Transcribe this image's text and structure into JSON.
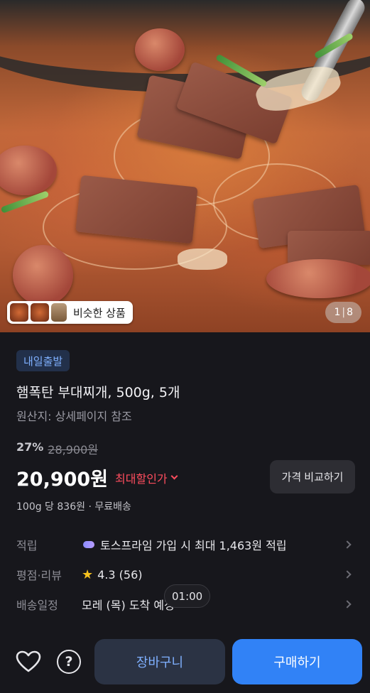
{
  "hero": {
    "similar_label": "비슷한 상품",
    "counter_current": "1",
    "counter_total": "8"
  },
  "product": {
    "badge": "내일출발",
    "title": "햄폭탄 부대찌개, 500g, 5개",
    "origin": "원산지: 상세페이지 참조",
    "discount": "27%",
    "original_price": "28,900원",
    "price": "20,900원",
    "max_discount_label": "최대할인가",
    "compare_label": "가격 비교하기",
    "unit_price": "100g 당 836원 · 무료배송"
  },
  "info": {
    "points_label": "적립",
    "points_value": "토스프라임 가입 시 최대 1,463원 적립",
    "rating_label": "평점·리뷰",
    "rating_value": "4.3 (56)",
    "delivery_label": "배송일정",
    "delivery_value": "모레 (목) 도착 예정"
  },
  "overlay": {
    "time": "01:00"
  },
  "bottom": {
    "cart_label": "장바구니",
    "buy_label": "구매하기"
  },
  "colors": {
    "accent": "#3182f6",
    "sale_red": "#ff4d5e",
    "star": "#f5c11e"
  },
  "icons": [
    "heart-icon",
    "question-icon",
    "chevron-right-icon",
    "chevron-down-icon",
    "star-icon",
    "cloud-icon"
  ]
}
